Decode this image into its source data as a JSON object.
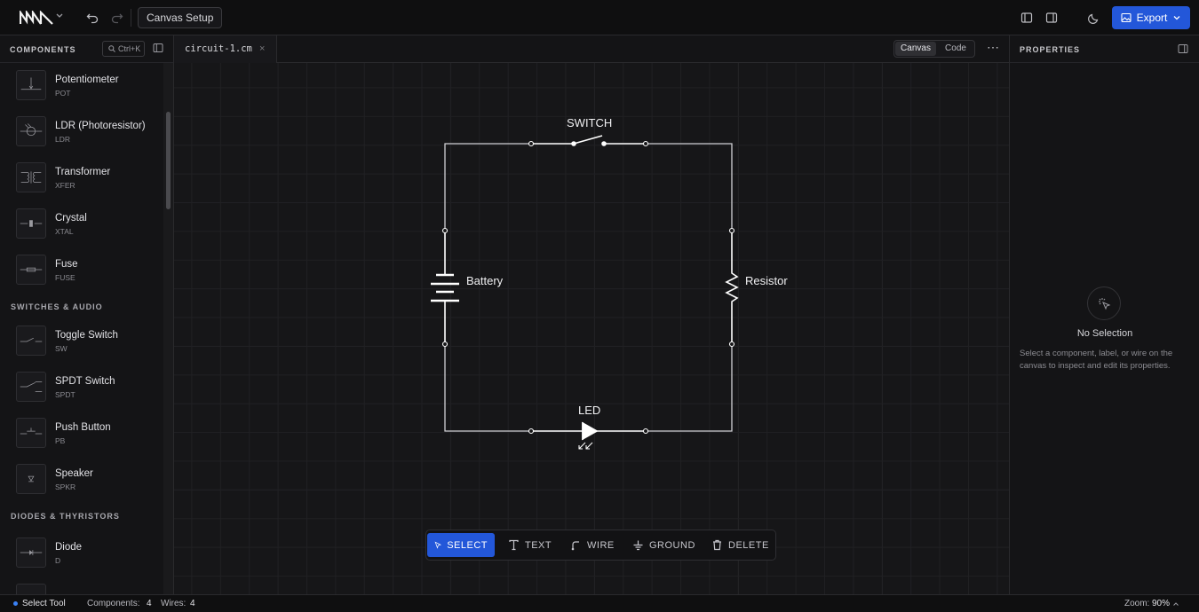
{
  "header": {
    "canvas_setup_label": "Canvas Setup",
    "export_label": "Export"
  },
  "sidebar": {
    "title": "COMPONENTS",
    "search_shortcut": "Ctrl+K",
    "items_top": [
      {
        "name": "Potentiometer",
        "code": "POT"
      },
      {
        "name": "LDR (Photoresistor)",
        "code": "LDR"
      },
      {
        "name": "Transformer",
        "code": "XFER"
      },
      {
        "name": "Crystal",
        "code": "XTAL"
      },
      {
        "name": "Fuse",
        "code": "FUSE"
      }
    ],
    "group_switches": "SWITCHES & AUDIO",
    "items_switches": [
      {
        "name": "Toggle Switch",
        "code": "SW"
      },
      {
        "name": "SPDT Switch",
        "code": "SPDT"
      },
      {
        "name": "Push Button",
        "code": "PB"
      },
      {
        "name": "Speaker",
        "code": "SPKR"
      }
    ],
    "group_diodes": "DIODES & THYRISTORS",
    "items_diodes": [
      {
        "name": "Diode",
        "code": "D"
      }
    ]
  },
  "tabs": {
    "file_name": "circuit-1.cm",
    "view_canvas": "Canvas",
    "view_code": "Code"
  },
  "circuit": {
    "switch_label": "SWITCH",
    "battery_label": "Battery",
    "resistor_label": "Resistor",
    "led_label": "LED"
  },
  "toolbar": {
    "select": "SELECT",
    "text": "TEXT",
    "wire": "WIRE",
    "ground": "GROUND",
    "delete": "DELETE"
  },
  "properties": {
    "title": "PROPERTIES",
    "empty_title": "No Selection",
    "empty_text": "Select a component, label, or wire on the canvas to inspect and edit its properties."
  },
  "status": {
    "tool": "Select Tool",
    "components_label": "Components:",
    "components_count": "4",
    "wires_label": "Wires:",
    "wires_count": "4",
    "zoom_label": "Zoom:",
    "zoom_value": "90%"
  },
  "colors": {
    "accent": "#2357d9",
    "background": "#111113"
  }
}
